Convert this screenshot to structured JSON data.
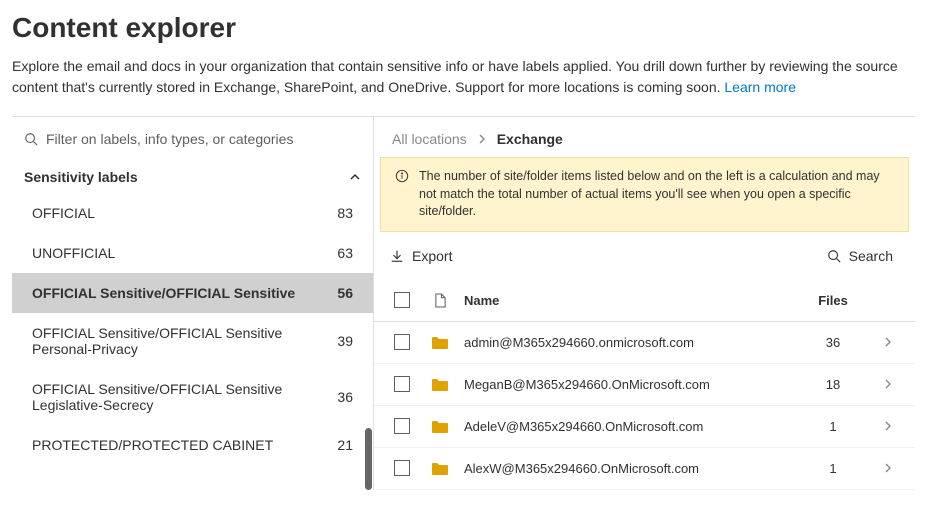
{
  "header": {
    "title": "Content explorer",
    "description_pre": "Explore the email and docs in your organization that contain sensitive info or have labels applied. You drill down further by reviewing the source content that's currently stored in Exchange, SharePoint, and OneDrive. Support for more locations is coming soon. ",
    "learn_more": "Learn more"
  },
  "filter": {
    "placeholder": "Filter on labels, info types, or categories"
  },
  "sidebar": {
    "section_title": "Sensitivity labels",
    "items": [
      {
        "name": "OFFICIAL",
        "count": "83",
        "selected": false
      },
      {
        "name": "UNOFFICIAL",
        "count": "63",
        "selected": false
      },
      {
        "name": "OFFICIAL Sensitive/OFFICIAL Sensitive",
        "count": "56",
        "selected": true
      },
      {
        "name": "OFFICIAL Sensitive/OFFICIAL Sensitive Personal-Privacy",
        "count": "39",
        "selected": false
      },
      {
        "name": "OFFICIAL Sensitive/OFFICIAL Sensitive Legislative-Secrecy",
        "count": "36",
        "selected": false
      },
      {
        "name": "PROTECTED/PROTECTED CABINET",
        "count": "21",
        "selected": false
      }
    ]
  },
  "breadcrumb": {
    "root": "All locations",
    "current": "Exchange"
  },
  "banner": {
    "text": "The number of site/folder items listed below and on the left is a calculation and may not match the total number of actual items you'll see when you open a specific site/folder."
  },
  "toolbar": {
    "export": "Export",
    "search": "Search"
  },
  "table": {
    "headers": {
      "name": "Name",
      "files": "Files"
    },
    "rows": [
      {
        "name": "admin@M365x294660.onmicrosoft.com",
        "files": "36"
      },
      {
        "name": "MeganB@M365x294660.OnMicrosoft.com",
        "files": "18"
      },
      {
        "name": "AdeleV@M365x294660.OnMicrosoft.com",
        "files": "1"
      },
      {
        "name": "AlexW@M365x294660.OnMicrosoft.com",
        "files": "1"
      }
    ]
  }
}
